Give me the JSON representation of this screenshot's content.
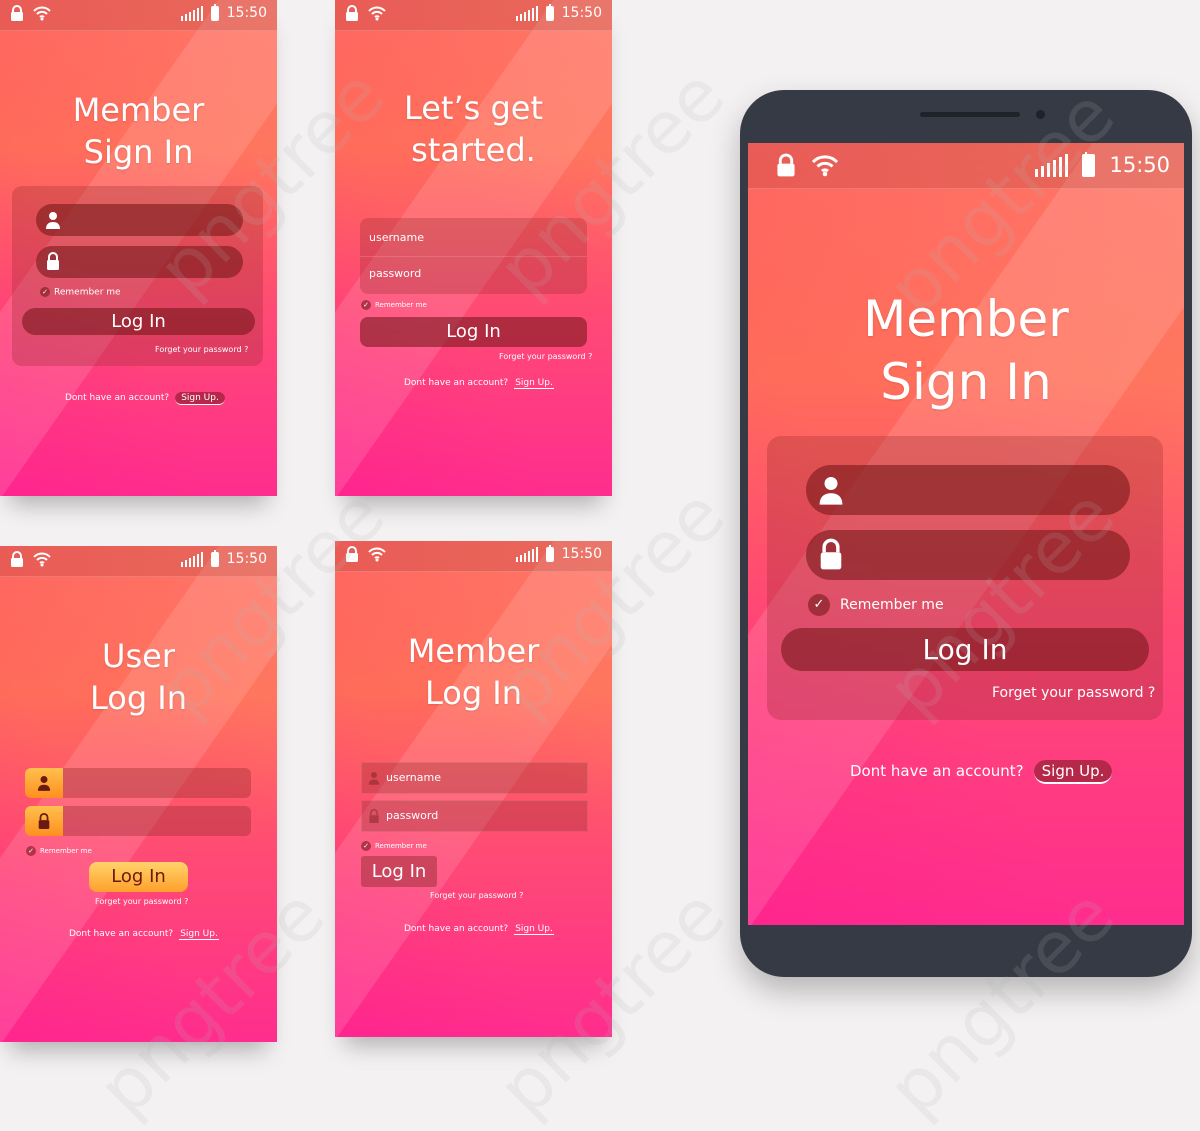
{
  "status": {
    "time": "15:50"
  },
  "screen1": {
    "title_line1": "Member",
    "title_line2": "Sign In",
    "remember": "Remember me",
    "login": "Log In",
    "forgot": "Forget your password ?",
    "no_account": "Dont have an account?",
    "signup": "Sign Up."
  },
  "screen2": {
    "title_line1": "Let’s get",
    "title_line2": "started.",
    "username": "username",
    "password": "password",
    "remember": "Remember me",
    "login": "Log In",
    "forgot": "Forget your password ?",
    "no_account": "Dont have an account?",
    "signup": "Sign Up."
  },
  "screen3": {
    "title_line1": "User",
    "title_line2": "Log In",
    "remember": "Remember me",
    "login": "Log In",
    "forgot": "Forget your password ?",
    "no_account": "Dont have an account?",
    "signup": "Sign Up."
  },
  "screen4": {
    "title_line1": "Member",
    "title_line2": "Log In",
    "username": "username",
    "password": "password",
    "remember": "Remember me",
    "login": "Log In",
    "forgot": "Forget your password ?",
    "no_account": "Dont have an account?",
    "signup": "Sign Up."
  },
  "phone_screen": {
    "title_line1": "Member",
    "title_line2": "Sign In",
    "remember": "Remember me",
    "login": "Log In",
    "forgot": "Forget your password ?",
    "no_account": "Dont have an account?",
    "signup": "Sign Up."
  },
  "watermark": "pngtree",
  "colors": {
    "gradient_top": "#ff5c5e",
    "gradient_bottom": "#ff2d8e",
    "phone_body": "#353a44",
    "orange_button": "#ffb347"
  }
}
